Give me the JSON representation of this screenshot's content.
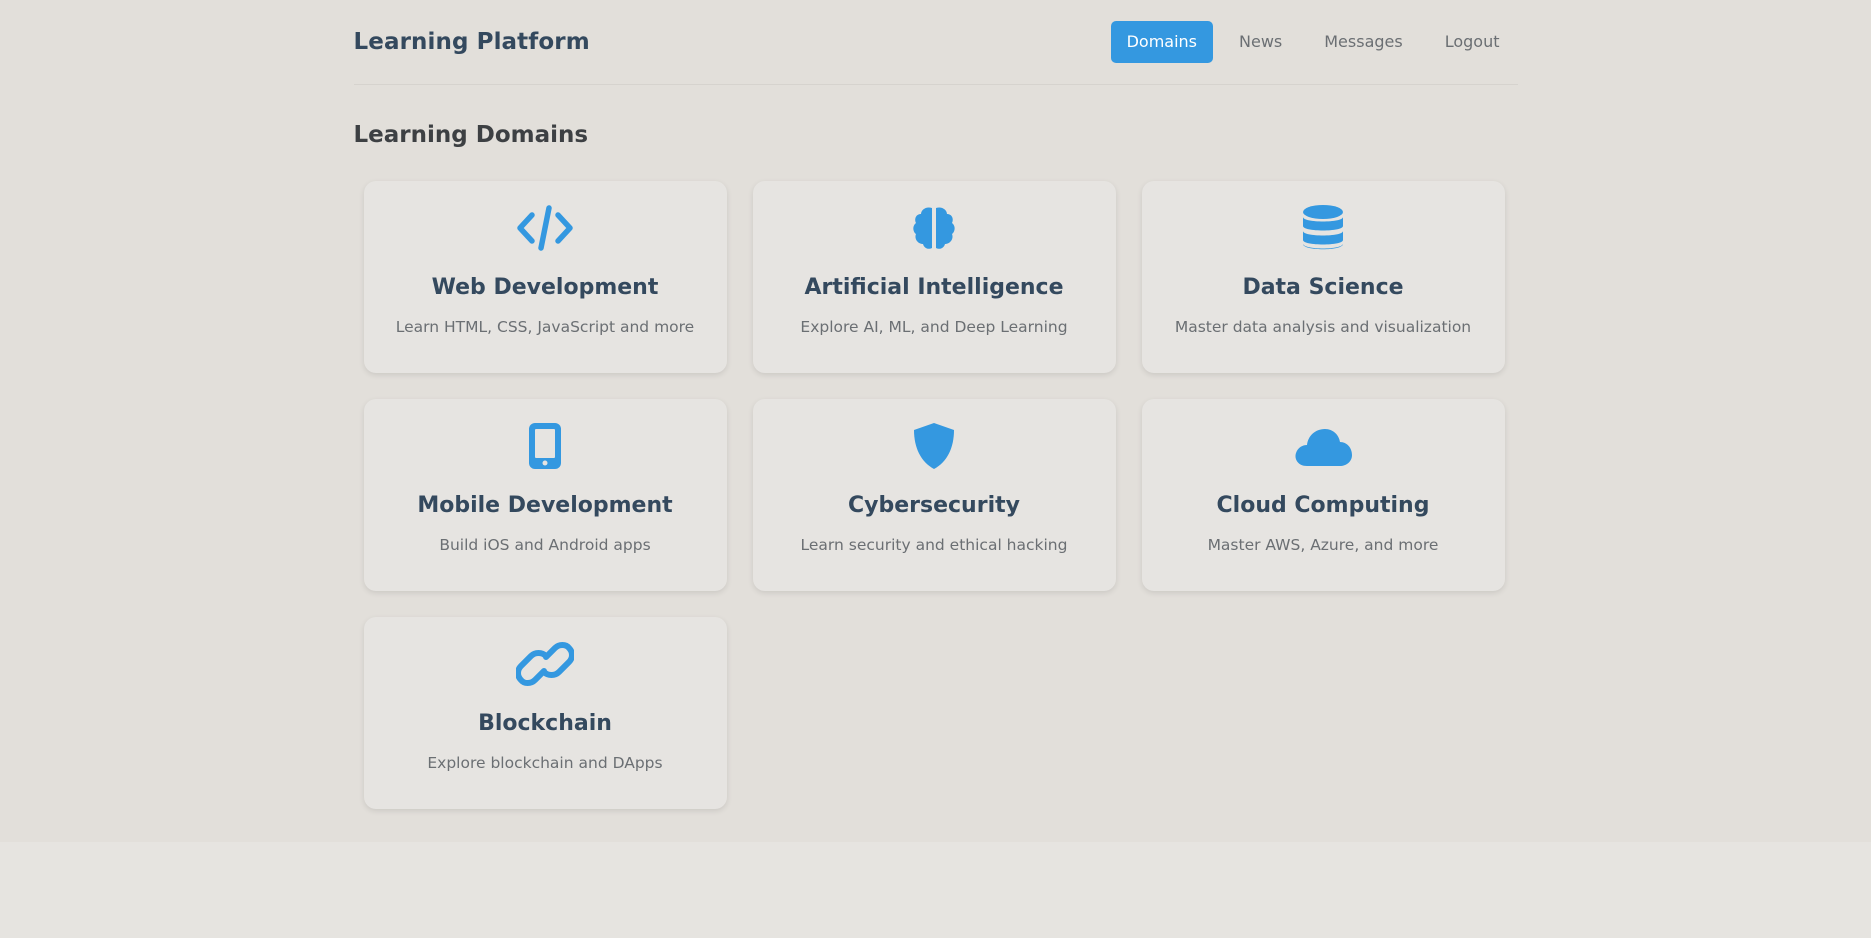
{
  "header": {
    "brand": "Learning Platform",
    "nav": [
      {
        "label": "Domains",
        "active": true
      },
      {
        "label": "News",
        "active": false
      },
      {
        "label": "Messages",
        "active": false
      },
      {
        "label": "Logout",
        "active": false
      }
    ]
  },
  "main": {
    "title": "Learning Domains",
    "domains": [
      {
        "icon": "code-icon",
        "title": "Web Development",
        "description": "Learn HTML, CSS, JavaScript and more"
      },
      {
        "icon": "brain-icon",
        "title": "Artificial Intelligence",
        "description": "Explore AI, ML, and Deep Learning"
      },
      {
        "icon": "database-icon",
        "title": "Data Science",
        "description": "Master data analysis and visualization"
      },
      {
        "icon": "mobile-icon",
        "title": "Mobile Development",
        "description": "Build iOS and Android apps"
      },
      {
        "icon": "shield-icon",
        "title": "Cybersecurity",
        "description": "Learn security and ethical hacking"
      },
      {
        "icon": "cloud-icon",
        "title": "Cloud Computing",
        "description": "Master AWS, Azure, and more"
      },
      {
        "icon": "link-icon",
        "title": "Blockchain",
        "description": "Explore blockchain and DApps"
      }
    ]
  },
  "colors": {
    "accent": "#3498e0",
    "title": "#34495e",
    "muted": "#6b6f73",
    "background": "#e2dfda"
  }
}
